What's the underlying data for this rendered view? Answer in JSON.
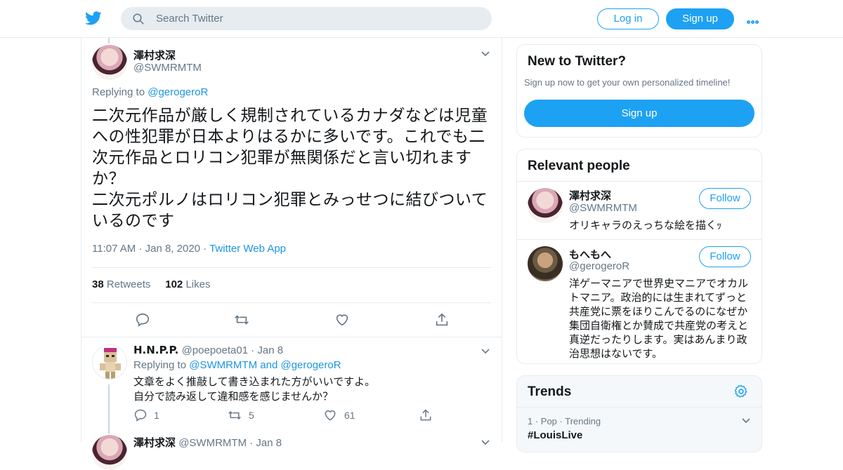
{
  "header": {
    "search_placeholder": "Search Twitter",
    "login_label": "Log in",
    "signup_label": "Sign up"
  },
  "tweet": {
    "author_name": "澤村求深",
    "author_handle": "@SWMRMTM",
    "replying_prefix": "Replying to",
    "replying_to": "@gerogeroR",
    "text": "二次元作品が厳しく規制されているカナダなどは児童への性犯罪が日本よりはるかに多いです。これでも二次元作品とロリコン犯罪が無関係だと言い切れますか？\n二次元ポルノはロリコン犯罪とみっせつに結びついているのです",
    "time": "11:07 AM",
    "date": "Jan 8, 2020",
    "source": "Twitter Web App",
    "retweets_count": "38",
    "retweets_label": "Retweets",
    "likes_count": "102",
    "likes_label": "Likes"
  },
  "replies": [
    {
      "name": "H.N.P.P.",
      "handle": "@poepoeta01",
      "date": "Jan 8",
      "replying_prefix": "Replying to",
      "replying_to_1": "@SWMRMTM",
      "replying_and": "and",
      "replying_to_2": "@gerogeroR",
      "text": "文章をよく推敲して書き込まれた方がいいですよ。\n自分で読み返して違和感を感じませんか？",
      "reply_count": "1",
      "retweet_count": "5",
      "like_count": "61"
    },
    {
      "name": "澤村求深",
      "handle": "@SWMRMTM",
      "date": "Jan 8"
    }
  ],
  "sidebar": {
    "new_title": "New to Twitter?",
    "new_sub": "Sign up now to get your own personalized timeline!",
    "new_signup": "Sign up",
    "relevant_title": "Relevant people",
    "people": [
      {
        "name": "澤村求深",
        "handle": "@SWMRMTM",
        "follow": "Follow",
        "bio": "オリキャラのえっちな絵を描くｯ"
      },
      {
        "name": "もへもへ",
        "handle": "@gerogeroR",
        "follow": "Follow",
        "bio": "洋ゲーマニアで世界史マニアでオカルトマニア。政治的には生まれてずっと共産党に票をほりこんでるのになぜか集団自衛権とか賛成で共産党の考えと真逆だったりします。実はあんまり政治思想はないです。"
      }
    ],
    "trends_title": "Trends",
    "trends": [
      {
        "meta": "1 · Pop · Trending",
        "name": "#LouisLive"
      }
    ]
  },
  "colors": {
    "accent": "#1da1f2",
    "link": "#1b95e0",
    "muted": "#657786",
    "border": "#e6ecf0"
  },
  "icons": [
    "twitter-bird-icon",
    "search-icon",
    "more-icon",
    "chevron-down-icon",
    "reply-icon",
    "retweet-icon",
    "like-icon",
    "share-icon",
    "gear-icon"
  ]
}
